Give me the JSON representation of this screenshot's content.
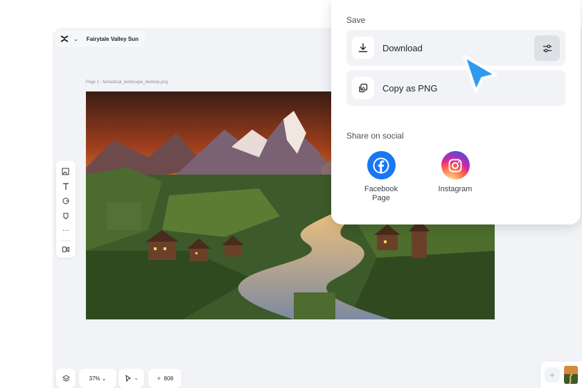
{
  "document": {
    "title": "Fairytale Valley Sun"
  },
  "page": {
    "label": "Page 1 -  fantastical_landscape_desktop.png"
  },
  "toolbar": {
    "tools": [
      "image-upload-icon",
      "text-icon",
      "shapes-icon",
      "elements-icon",
      "more-icon",
      "record-icon"
    ]
  },
  "bottom_bar": {
    "zoom": "37% ⌄",
    "count": "808"
  },
  "save_panel": {
    "heading": "Save",
    "download_label": "Download",
    "copy_label": "Copy as PNG",
    "share_heading": "Share on social",
    "social": [
      {
        "name": "Facebook\nPage",
        "color": "#1877f2"
      },
      {
        "name": "Instagram",
        "color": "#dd2a7b"
      }
    ]
  },
  "colors": {
    "accent": "#2f9bf0",
    "panel_bg": "#ffffff",
    "row_bg": "#f1f3f6"
  }
}
